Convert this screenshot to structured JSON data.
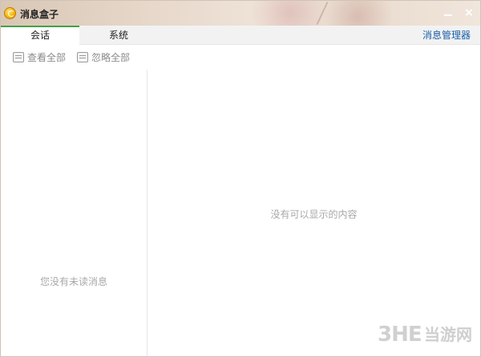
{
  "window": {
    "title": "消息盒子",
    "icon": "app-logo-icon",
    "controls": {
      "minimize": "minimize-icon",
      "close": "×"
    }
  },
  "tabs": [
    {
      "label": "会话",
      "active": true
    },
    {
      "label": "系统",
      "active": false
    }
  ],
  "header": {
    "manager_link": "消息管理器"
  },
  "toolbar": {
    "view_all": "查看全部",
    "ignore_all": "忽略全部"
  },
  "left_panel": {
    "empty_text": "您没有未读消息"
  },
  "right_panel": {
    "empty_text": "没有可以显示的内容"
  },
  "watermark": {
    "logo": "3HE",
    "text": "当游网"
  },
  "colors": {
    "active_tab_accent": "#43a047",
    "link": "#1a5fa8",
    "muted_text": "#a8a8a8"
  }
}
